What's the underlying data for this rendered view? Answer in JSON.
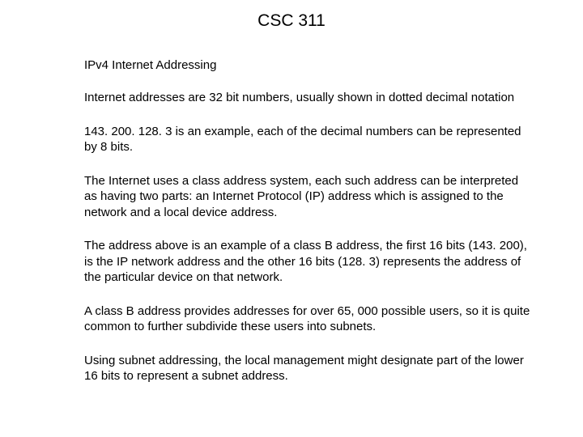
{
  "title": "CSC 311",
  "subtitle": "IPv4 Internet Addressing",
  "paragraphs": [
    "Internet addresses are 32 bit numbers, usually shown in dotted decimal notation",
    "143. 200. 128. 3 is an example, each of the decimal numbers can be represented by 8 bits.",
    "The Internet uses a class address system, each such address can be interpreted as having two parts:  an Internet Protocol (IP) address which is assigned to the network and a local device address.",
    "The address above is an example of a class B address, the first 16 bits (143. 200), is the IP network address and the other 16 bits (128. 3) represents the address of the particular device on that network.",
    "A class B address provides addresses for over 65, 000 possible users, so it is quite common to further subdivide these users into subnets.",
    "Using subnet addressing, the local management might designate part of the lower 16 bits to represent a subnet address."
  ]
}
